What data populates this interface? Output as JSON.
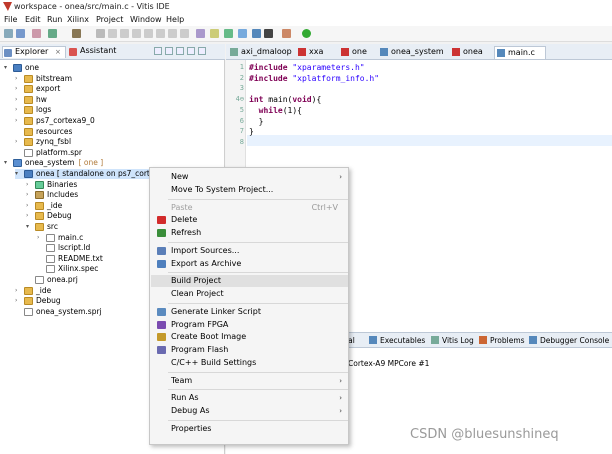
{
  "window": {
    "title": "workspace - onea/src/main.c - Vitis IDE"
  },
  "menubar": [
    "File",
    "Edit",
    "Run",
    "Xilinx",
    "Project",
    "Window",
    "Help"
  ],
  "explorer": {
    "tabs": [
      "Explorer",
      "Assistant"
    ],
    "tree": [
      {
        "arrow": "▾",
        "icon": "proj",
        "label": "one",
        "depth": 0
      },
      {
        "arrow": "›",
        "icon": "folder",
        "label": "bitstream",
        "depth": 1
      },
      {
        "arrow": "›",
        "icon": "folder",
        "label": "export",
        "depth": 1
      },
      {
        "arrow": "›",
        "icon": "folder",
        "label": "hw",
        "depth": 1
      },
      {
        "arrow": "›",
        "icon": "folder",
        "label": "logs",
        "depth": 1
      },
      {
        "arrow": "›",
        "icon": "folder",
        "label": "ps7_cortexa9_0",
        "depth": 1
      },
      {
        "arrow": "",
        "icon": "folder",
        "label": "resources",
        "depth": 1
      },
      {
        "arrow": "›",
        "icon": "folder",
        "label": "zynq_fsbl",
        "depth": 1
      },
      {
        "arrow": "",
        "icon": "file",
        "label": "platform.spr",
        "depth": 1
      },
      {
        "arrow": "▾",
        "icon": "sys",
        "label": "onea_system",
        "suffix": "[ one ]",
        "depth": 0
      },
      {
        "arrow": "▾",
        "icon": "proj",
        "label": "onea [ standalone on ps7_cortex",
        "depth": 1,
        "selected": true
      },
      {
        "arrow": "›",
        "icon": "bin",
        "label": "Binaries",
        "depth": 2
      },
      {
        "arrow": "›",
        "icon": "inc",
        "label": "Includes",
        "depth": 2
      },
      {
        "arrow": "›",
        "icon": "folder",
        "label": "_ide",
        "depth": 2
      },
      {
        "arrow": "›",
        "icon": "folder",
        "label": "Debug",
        "depth": 2
      },
      {
        "arrow": "▾",
        "icon": "folder",
        "label": "src",
        "depth": 2
      },
      {
        "arrow": "›",
        "icon": "file",
        "label": "main.c",
        "depth": 3
      },
      {
        "arrow": "",
        "icon": "file",
        "label": "lscript.ld",
        "depth": 3
      },
      {
        "arrow": "",
        "icon": "file",
        "label": "README.txt",
        "depth": 3
      },
      {
        "arrow": "",
        "icon": "file",
        "label": "Xilinx.spec",
        "depth": 3
      },
      {
        "arrow": "",
        "icon": "file",
        "label": "onea.prj",
        "depth": 2
      },
      {
        "arrow": "›",
        "icon": "folder",
        "label": "_ide",
        "depth": 1
      },
      {
        "arrow": "›",
        "icon": "folder",
        "label": "Debug",
        "depth": 1
      },
      {
        "arrow": "",
        "icon": "file",
        "label": "onea_system.sprj",
        "depth": 1
      }
    ]
  },
  "editor": {
    "tabs": [
      "axi_dmaloop",
      "xxa",
      "one",
      "onea_system",
      "onea",
      "main.c"
    ],
    "active_tab": 5,
    "lines": [
      {
        "num": "1",
        "parts": [
          [
            "kw",
            "#include "
          ],
          [
            "str",
            "\"xparameters.h\""
          ]
        ]
      },
      {
        "num": "2",
        "parts": [
          [
            "kw",
            "#include "
          ],
          [
            "str",
            "\"xplatform_info.h\""
          ]
        ]
      },
      {
        "num": "3",
        "parts": []
      },
      {
        "num": "4⊖",
        "parts": [
          [
            "kw",
            "int "
          ],
          [
            "",
            "main("
          ],
          [
            "kw",
            "void"
          ],
          [
            "",
            "){"
          ]
        ]
      },
      {
        "num": "5",
        "parts": [
          [
            "",
            "  "
          ],
          [
            "kw",
            "while"
          ],
          [
            "",
            "(1){"
          ]
        ]
      },
      {
        "num": "6",
        "parts": [
          [
            "",
            "  }"
          ]
        ]
      },
      {
        "num": "7",
        "parts": [
          [
            "",
            "}"
          ]
        ]
      },
      {
        "num": "8",
        "parts": []
      }
    ]
  },
  "console": {
    "tabs": [
      "minal",
      "Executables",
      "Vitis Log",
      "Problems",
      "Debugger Console"
    ],
    "line": "Cortex-A9 MPCore #1"
  },
  "context_menu": {
    "items": [
      {
        "label": "New",
        "submenu": true
      },
      {
        "label": "Move To System Project..."
      },
      {
        "sep": true
      },
      {
        "label": "Paste",
        "shortcut": "Ctrl+V",
        "disabled": true
      },
      {
        "label": "Delete",
        "icon": "delete"
      },
      {
        "label": "Refresh",
        "icon": "refresh"
      },
      {
        "sep": true
      },
      {
        "label": "Import Sources...",
        "icon": "import"
      },
      {
        "label": "Export as Archive",
        "icon": "export"
      },
      {
        "sep": true
      },
      {
        "label": "Build Project",
        "highlight": true
      },
      {
        "label": "Clean Project"
      },
      {
        "sep": true
      },
      {
        "label": "Generate Linker Script",
        "icon": "linker"
      },
      {
        "label": "Program FPGA",
        "icon": "fpga"
      },
      {
        "label": "Create Boot Image",
        "icon": "boot"
      },
      {
        "label": "Program Flash",
        "icon": "flash"
      },
      {
        "label": "C/C++ Build Settings"
      },
      {
        "sep": true
      },
      {
        "label": "Team",
        "submenu": true
      },
      {
        "sep": true
      },
      {
        "label": "Run As",
        "submenu": true
      },
      {
        "label": "Debug As",
        "submenu": true
      },
      {
        "sep": true
      },
      {
        "label": "Properties"
      }
    ]
  },
  "colors": {
    "accent": "#cfe4fb",
    "delete": "#d22b2b"
  },
  "watermark": "CSDN @bluesunshineq"
}
